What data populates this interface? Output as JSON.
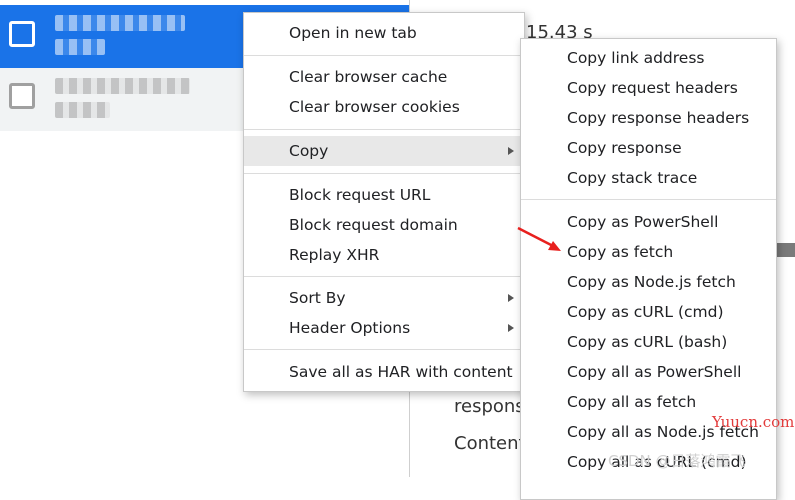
{
  "background": {
    "timing_text": "15.43 s",
    "response_label": "respons",
    "content_label": "Content"
  },
  "main_menu": {
    "items": [
      {
        "label": "Open in new tab"
      },
      {
        "label": "Clear browser cache"
      },
      {
        "label": "Clear browser cookies"
      },
      {
        "label": "Copy",
        "has_submenu": true,
        "highlighted": true
      },
      {
        "label": "Block request URL"
      },
      {
        "label": "Block request domain"
      },
      {
        "label": "Replay XHR"
      },
      {
        "label": "Sort By",
        "has_submenu": true
      },
      {
        "label": "Header Options",
        "has_submenu": true
      },
      {
        "label": "Save all as HAR with content"
      }
    ]
  },
  "copy_submenu": {
    "items": [
      {
        "label": "Copy link address"
      },
      {
        "label": "Copy request headers"
      },
      {
        "label": "Copy response headers"
      },
      {
        "label": "Copy response"
      },
      {
        "label": "Copy stack trace"
      },
      {
        "label": "Copy as PowerShell"
      },
      {
        "label": "Copy as fetch"
      },
      {
        "label": "Copy as Node.js fetch"
      },
      {
        "label": "Copy as cURL (cmd)"
      },
      {
        "label": "Copy as cURL (bash)"
      },
      {
        "label": "Copy all as PowerShell"
      },
      {
        "label": "Copy all as fetch"
      },
      {
        "label": "Copy all as Node.js fetch"
      },
      {
        "label": "Copy all as cURL (cmd)"
      }
    ]
  },
  "watermark": {
    "brand": "Yuucn.com",
    "credit": "CSDN @日落鸿霞飞"
  },
  "colors": {
    "selected_row": "#1a73e8",
    "highlight": "#e8e8e8",
    "annotation_arrow": "#e8201e"
  }
}
